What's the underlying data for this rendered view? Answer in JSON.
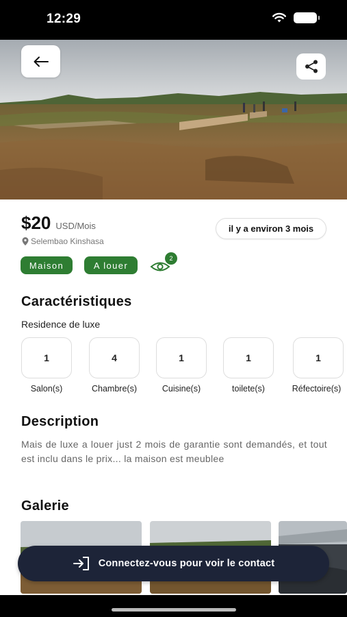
{
  "status_bar": {
    "time": "12:29"
  },
  "header": {
    "back_icon": "arrow-left-icon",
    "share_icon": "share-icon"
  },
  "listing": {
    "price": "$20",
    "price_unit": "USD/Mois",
    "location": "Selembao Kinshasa",
    "posted": "il y a environ 3 mois",
    "type_tag": "Maison",
    "status_tag": "A louer",
    "views": "2"
  },
  "characteristics": {
    "title": "Caractéristiques",
    "subtitle": "Residence de luxe",
    "items": [
      {
        "value": "1",
        "label": "Salon(s)"
      },
      {
        "value": "4",
        "label": "Chambre(s)"
      },
      {
        "value": "1",
        "label": "Cuisine(s)"
      },
      {
        "value": "1",
        "label": "toilete(s)"
      },
      {
        "value": "1",
        "label": "Réfectoire(s)"
      }
    ]
  },
  "description": {
    "title": "Description",
    "text": "Mais de luxe a louer just 2 mois de garantie sont demandés, et tout est inclu dans le prix... la maison est meublee"
  },
  "gallery": {
    "title": "Galerie"
  },
  "contact": {
    "label": "Connectez-vous pour voir le contact",
    "icon": "login-icon"
  },
  "colors": {
    "accent_green": "#2e7d32",
    "button_dark": "#1d2438"
  }
}
